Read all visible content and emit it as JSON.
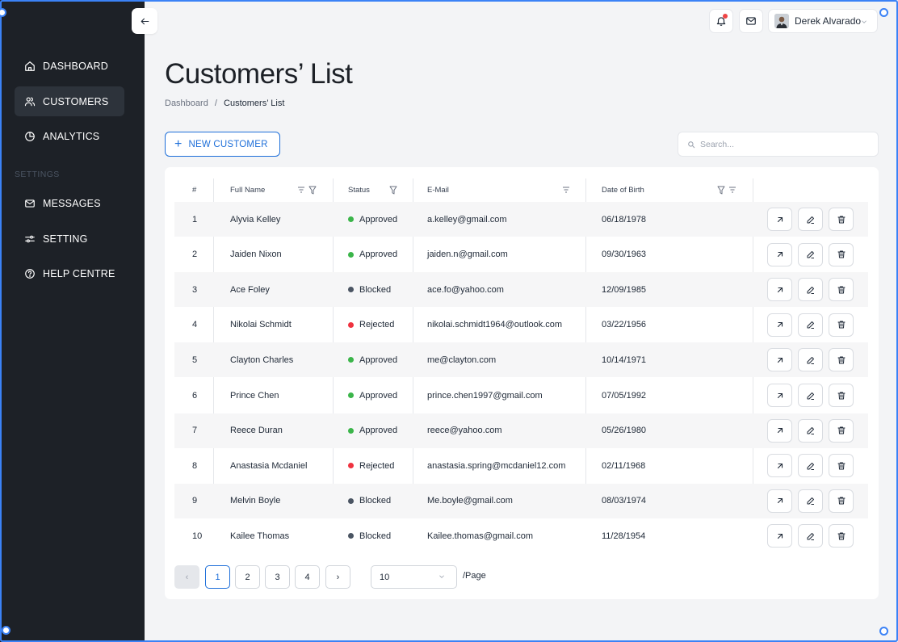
{
  "sidebar": {
    "items": [
      {
        "label": "DASHBOARD",
        "icon": "home-icon"
      },
      {
        "label": "CUSTOMERS",
        "icon": "users-icon",
        "active": true
      },
      {
        "label": "ANALYTICS",
        "icon": "pie-chart-icon"
      }
    ],
    "section_title": "SETTINGS",
    "settings_items": [
      {
        "label": "MESSAGES",
        "icon": "mail-icon"
      },
      {
        "label": "SETTING",
        "icon": "sliders-icon"
      },
      {
        "label": "HELP CENTRE",
        "icon": "help-circle-icon"
      }
    ]
  },
  "header": {
    "user_name": "Derek Alvarado",
    "has_notification": true
  },
  "page": {
    "title": "Customers’ List",
    "breadcrumb": {
      "root": "Dashboard",
      "separator": "/",
      "current": "Customers’ List"
    }
  },
  "toolbar": {
    "new_customer_label": "NEW CUSTOMER",
    "search_placeholder": "Search..."
  },
  "table": {
    "columns": {
      "index": "#",
      "name": "Full Name",
      "status": "Status",
      "email": "E-Mail",
      "dob": "Date of Birth"
    },
    "rows": [
      {
        "index": "1",
        "name": "Alyvia Kelley",
        "status": "Approved",
        "email": "a.kelley@gmail.com",
        "dob": "06/18/1978"
      },
      {
        "index": "2",
        "name": "Jaiden Nixon",
        "status": "Approved",
        "email": "jaiden.n@gmail.com",
        "dob": "09/30/1963"
      },
      {
        "index": "3",
        "name": "Ace Foley",
        "status": "Blocked",
        "email": "ace.fo@yahoo.com",
        "dob": "12/09/1985"
      },
      {
        "index": "4",
        "name": "Nikolai Schmidt",
        "status": "Rejected",
        "email": "nikolai.schmidt1964@outlook.com",
        "dob": "03/22/1956"
      },
      {
        "index": "5",
        "name": "Clayton Charles",
        "status": "Approved",
        "email": "me@clayton.com",
        "dob": "10/14/1971"
      },
      {
        "index": "6",
        "name": "Prince Chen",
        "status": "Approved",
        "email": "prince.chen1997@gmail.com",
        "dob": "07/05/1992"
      },
      {
        "index": "7",
        "name": "Reece Duran",
        "status": "Approved",
        "email": "reece@yahoo.com",
        "dob": "05/26/1980"
      },
      {
        "index": "8",
        "name": "Anastasia Mcdaniel",
        "status": "Rejected",
        "email": "anastasia.spring@mcdaniel12.com",
        "dob": "02/11/1968"
      },
      {
        "index": "9",
        "name": "Melvin Boyle",
        "status": "Blocked",
        "email": "Me.boyle@gmail.com",
        "dob": "08/03/1974"
      },
      {
        "index": "10",
        "name": "Kailee Thomas",
        "status": "Blocked",
        "email": "Kailee.thomas@gmail.com",
        "dob": "11/28/1954"
      }
    ],
    "status_colors": {
      "Approved": "#3bb54a",
      "Blocked": "#4b5563",
      "Rejected": "#ef3340"
    }
  },
  "pagination": {
    "prev": "‹",
    "pages": [
      "1",
      "2",
      "3",
      "4"
    ],
    "current_page": "1",
    "next": "›",
    "per_page_value": "10",
    "per_page_label": "/Page"
  },
  "colors": {
    "accent": "#1e6fd9",
    "sidebar_bg": "#1d2127",
    "notification": "#ef4444"
  }
}
